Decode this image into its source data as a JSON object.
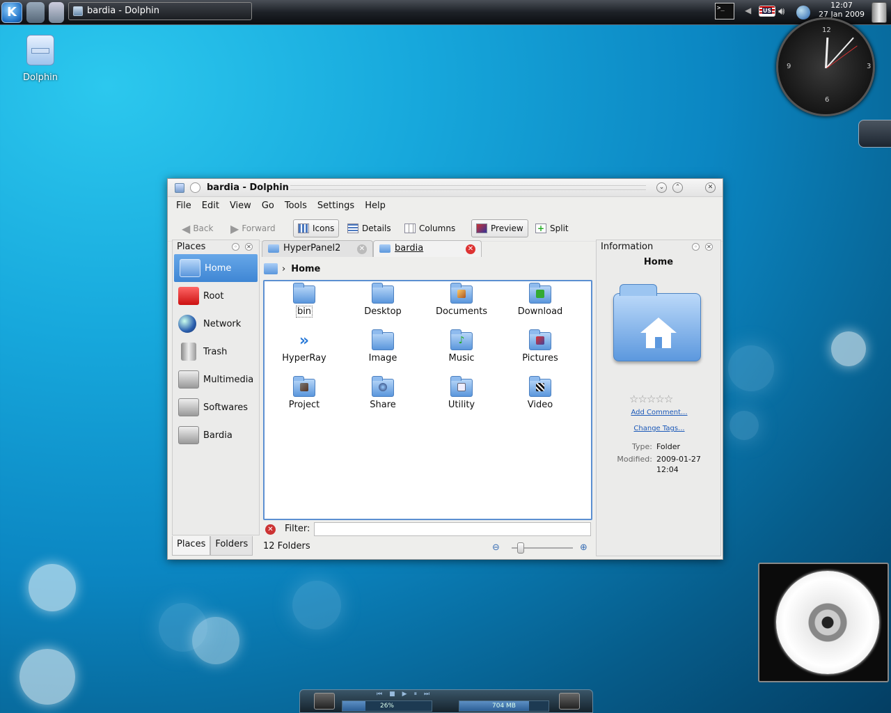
{
  "panel": {
    "task_title": "bardia - Dolphin",
    "clock_time": "12:07",
    "clock_date": "27 Jan 2009",
    "keyboard_layout": "US",
    "kde_logo": "K"
  },
  "desktop": {
    "icon_label": "Dolphin"
  },
  "window": {
    "title": "bardia - Dolphin",
    "menu": [
      "File",
      "Edit",
      "View",
      "Go",
      "Tools",
      "Settings",
      "Help"
    ],
    "toolbar": {
      "back": "Back",
      "forward": "Forward",
      "icons": "Icons",
      "details": "Details",
      "columns": "Columns",
      "preview": "Preview",
      "split": "Split"
    },
    "places": {
      "title": "Places",
      "items": [
        "Home",
        "Root",
        "Network",
        "Trash",
        "Multimedia",
        "Softwares",
        "Bardia"
      ],
      "selected": "Home",
      "tabs": [
        "Places",
        "Folders"
      ]
    },
    "tabs": [
      "HyperPanel2",
      "bardia"
    ],
    "breadcrumb": "Home",
    "files": [
      "bin",
      "Desktop",
      "Documents",
      "Download",
      "HyperRay",
      "Image",
      "Music",
      "Pictures",
      "Project",
      "Share",
      "Utility",
      "Video"
    ],
    "filter_label": "Filter:",
    "filter_value": "",
    "status": "12 Folders",
    "zoom_level": 0.1,
    "info": {
      "title": "Information",
      "name": "Home",
      "rating": 0,
      "add_comment": "Add Comment...",
      "change_tags": "Change Tags...",
      "type_label": "Type:",
      "type_value": "Folder",
      "modified_label": "Modified:",
      "modified_date": "2009-01-27",
      "modified_time": "12:04"
    }
  },
  "system_monitor": {
    "cpu": "26%",
    "cpu_fraction": 0.26,
    "memory": "704 MB",
    "memory_fraction": 0.78
  },
  "clock_widget": {
    "numerals": [
      "12",
      "3",
      "6",
      "9"
    ]
  },
  "colors": {
    "selection": "#3f86d4",
    "folder": "#5a96dc",
    "desktop": "#0b86c2"
  }
}
